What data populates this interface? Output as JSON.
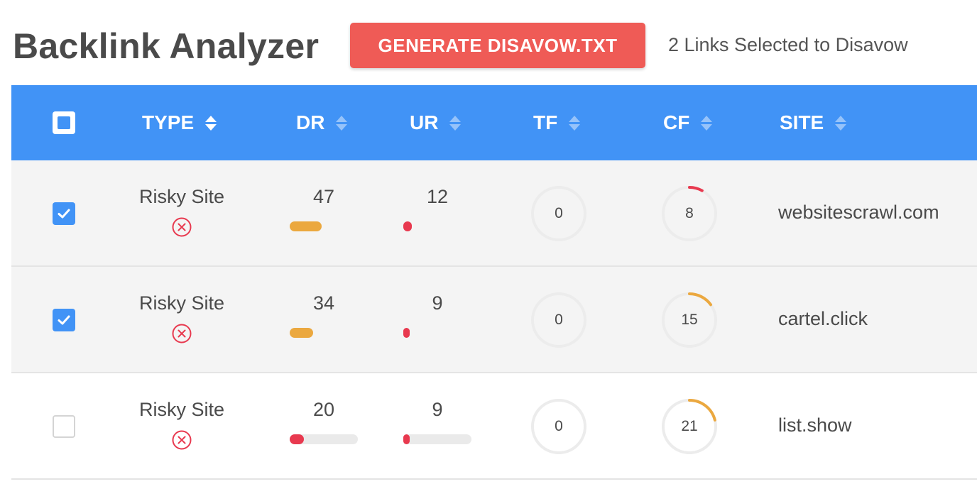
{
  "header": {
    "title": "Backlink Analyzer",
    "generate_button": "GENERATE DISAVOW.TXT",
    "selected_status": "2 Links Selected to Disavow"
  },
  "columns": {
    "type": "TYPE",
    "dr": "DR",
    "ur": "UR",
    "tf": "TF",
    "cf": "CF",
    "site": "SITE"
  },
  "colors": {
    "header_bg": "#4193f6",
    "button_bg": "#ef5b56",
    "risk_red": "#e8394f",
    "warn_orange": "#eba83f"
  },
  "rows": [
    {
      "checked": true,
      "type": "Risky Site",
      "type_icon": "x-circle-icon",
      "dr": "47",
      "ur": "12",
      "tf": "0",
      "cf": "8",
      "site": "websitescrawl.com"
    },
    {
      "checked": true,
      "type": "Risky Site",
      "type_icon": "x-circle-icon",
      "dr": "34",
      "ur": "9",
      "tf": "0",
      "cf": "15",
      "site": "cartel.click"
    },
    {
      "checked": false,
      "type": "Risky Site",
      "type_icon": "x-circle-icon",
      "dr": "20",
      "ur": "9",
      "tf": "0",
      "cf": "21",
      "site": "list.show"
    }
  ]
}
